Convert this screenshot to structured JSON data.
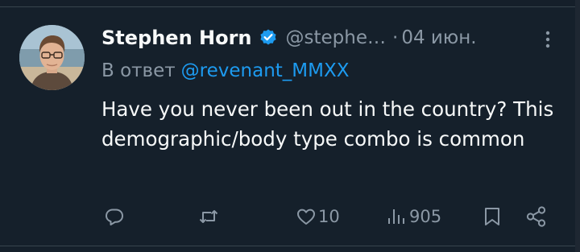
{
  "tweet": {
    "author": {
      "display_name": "Stephen Horn",
      "handle": "@stephe…",
      "verified": true
    },
    "separator": "·",
    "date": "04 июн.",
    "reply": {
      "prefix": "В ответ",
      "mention": "@revenant_MMXX"
    },
    "text": "Have you never been out in the country? This demographic/body type combo is common",
    "actions": {
      "reply_icon": "comment-bubble-icon",
      "retweet_icon": "retweet-arrows-icon",
      "like_icon": "heart-icon",
      "like_count": "10",
      "views_icon": "bar-chart-icon",
      "views_count": "905",
      "bookmark_icon": "bookmark-icon",
      "share_icon": "share-nodes-icon"
    }
  },
  "colors": {
    "background": "#15202b",
    "primary_text": "#f7f9f9",
    "secondary_text": "#8b98a5",
    "link": "#1d9bf0",
    "verified_badge": "#1d9bf0",
    "divider": "#38444d"
  }
}
